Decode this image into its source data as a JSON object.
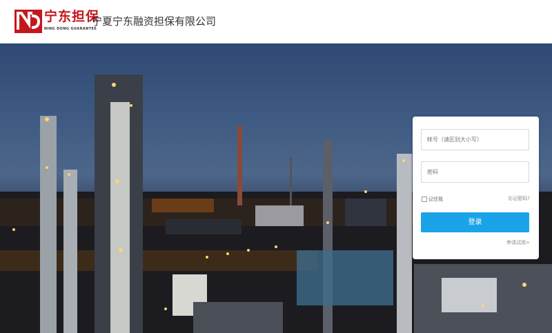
{
  "header": {
    "brand_cn": "宁东担保",
    "brand_en": "NING DONG GUARANTEE",
    "company_name": "宁夏宁东融资担保有限公司",
    "logo_color": "#c4171d"
  },
  "login": {
    "username_placeholder": "帐号（请区别大小写）",
    "password_placeholder": "密码",
    "remember_label": "记住我",
    "forgot_label": "忘记密码?",
    "submit_label": "登录",
    "trial_label": "申请试用>",
    "accent_color": "#1aa3e8"
  }
}
